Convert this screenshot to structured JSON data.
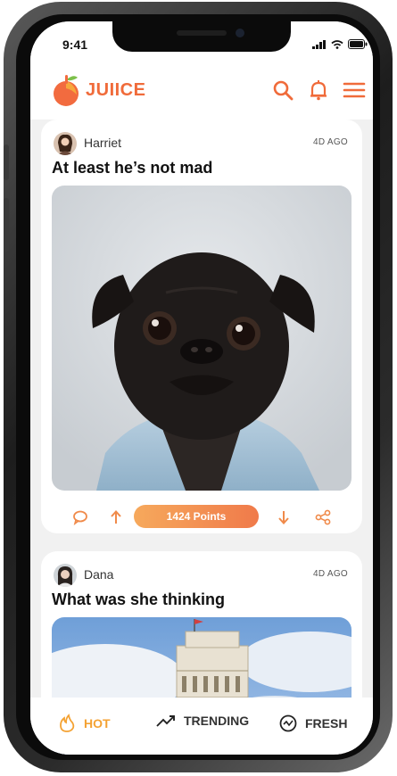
{
  "status_bar": {
    "time": "9:41"
  },
  "app": {
    "brand": "JUIICE"
  },
  "colors": {
    "accent": "#f06b3a",
    "active_tab": "#f4a233",
    "points_start": "#f6a95c",
    "points_end": "#f07a4a"
  },
  "header_icons": [
    "search-icon",
    "bell-icon",
    "menu-icon"
  ],
  "posts": [
    {
      "author": "Harriet",
      "ago": "4D AGO",
      "title": "At least he’s not mad",
      "points": "1424 Points",
      "image": "black pug in denim jacket"
    },
    {
      "author": "Dana",
      "ago": "4D AGO",
      "title": "What was she thinking",
      "image": "leaning tower under blue sky"
    }
  ],
  "tabs": [
    {
      "label": "HOT",
      "icon": "flame-icon",
      "active": true
    },
    {
      "label": "TRENDING",
      "icon": "trend-icon",
      "active": false
    },
    {
      "label": "FRESH",
      "icon": "fresh-icon",
      "active": false
    }
  ]
}
